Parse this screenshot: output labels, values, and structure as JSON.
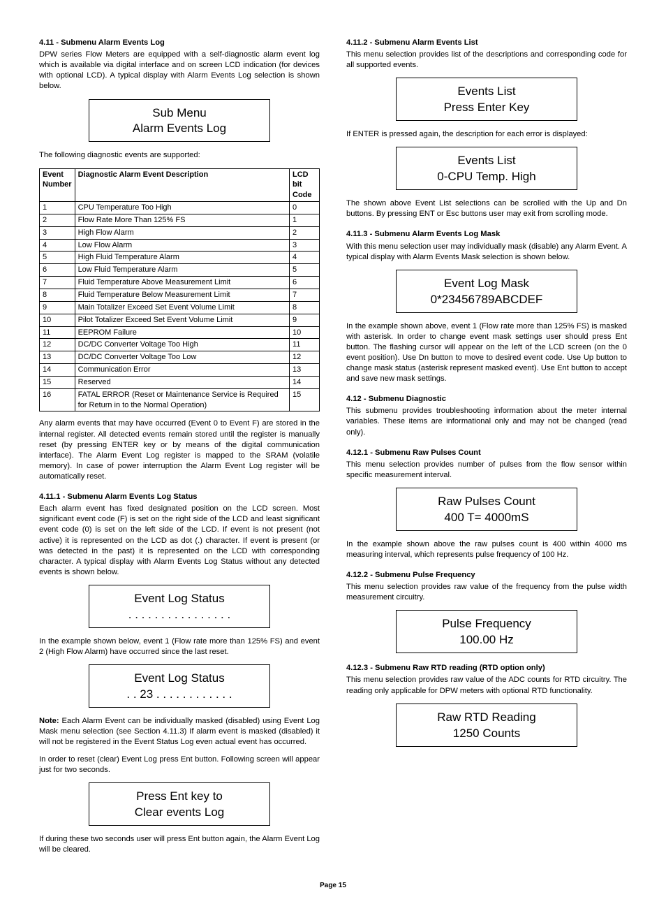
{
  "left": {
    "s411_head": "4.11 - Submenu Alarm Events Log",
    "s411_p1": "DPW series Flow Meters are equipped with a self-diagnostic alarm event log which is available via digital interface and on screen LCD indication (for devices with optional LCD). A typical display with Alarm Events Log selection is shown below.",
    "lcd1_l1": "Sub Menu",
    "lcd1_l2": "Alarm Events Log",
    "s411_p2": "The following diagnostic events are supported:",
    "table": {
      "h1": "Event Number",
      "h2": "Diagnostic Alarm Event Description",
      "h3": "LCD bit Code",
      "rows": [
        {
          "n": "1",
          "d": "CPU Temperature Too High",
          "c": "0"
        },
        {
          "n": "2",
          "d": "Flow Rate More Than 125% FS",
          "c": "1"
        },
        {
          "n": "3",
          "d": "High Flow Alarm",
          "c": "2"
        },
        {
          "n": "4",
          "d": "Low Flow Alarm",
          "c": "3"
        },
        {
          "n": "5",
          "d": "High Fluid Temperature Alarm",
          "c": "4"
        },
        {
          "n": "6",
          "d": "Low Fluid Temperature Alarm",
          "c": "5"
        },
        {
          "n": "7",
          "d": "Fluid Temperature Above Measurement Limit",
          "c": "6"
        },
        {
          "n": "8",
          "d": "Fluid Temperature Below Measurement Limit",
          "c": "7"
        },
        {
          "n": "9",
          "d": "Main Totalizer Exceed Set Event Volume Limit",
          "c": "8"
        },
        {
          "n": "10",
          "d": "Pilot Totalizer Exceed Set Event Volume Limit",
          "c": "9"
        },
        {
          "n": "11",
          "d": "EEPROM Failure",
          "c": "10"
        },
        {
          "n": "12",
          "d": "DC/DC Converter Voltage Too High",
          "c": "11"
        },
        {
          "n": "13",
          "d": "DC/DC Converter Voltage Too Low",
          "c": "12"
        },
        {
          "n": "14",
          "d": "Communication Error",
          "c": "13"
        },
        {
          "n": "15",
          "d": "Reserved",
          "c": "14"
        },
        {
          "n": "16",
          "d": "FATAL ERROR (Reset or Maintenance Service is Required for Return in to the Normal Operation)",
          "c": "15"
        }
      ]
    },
    "s411_p3": "Any alarm events that may have occurred (Event 0 to Event F) are stored in the internal register. All detected events remain stored until the register is manually reset (by pressing ENTER key or by means of the digital communication interface). The Alarm Event Log register is mapped to the SRAM (volatile memory). In case of power interruption the Alarm Event Log register will be automatically reset.",
    "s4111_head": "4.11.1 - Submenu Alarm Events Log Status",
    "s4111_p1": "Each alarm event has fixed designated position on the LCD screen. Most significant event code (F) is set on the right side of the LCD and least significant event code (0) is set on the left side of the LCD. If event is not present (not active) it is represented on the LCD as dot (.) character. If event is present (or was detected in the past) it is represented on the LCD with corresponding character. A typical display with Alarm Events Log Status without any detected events is shown below.",
    "lcd2_l1": "Event Log Status",
    "lcd2_l2": ". . . . . . . . . . . . . . . .",
    "s4111_p2": "In the example shown below, event 1 (Flow rate more than 125% FS) and event 2 (High Flow Alarm) have occurred since the last reset.",
    "lcd3_l1": "Event Log Status",
    "lcd3_l2": ". . 23 . . . . . . . . . . . .",
    "note_lead": "Note:",
    "note_body": " Each Alarm Event can be individually masked (disabled) using Event Log Mask menu selection (see Section 4.11.3) If alarm event is masked (disabled) it will not be registered in the Event Status Log even actual event has occurred.",
    "s4111_p3": "In order to reset (clear) Event Log press Ent button. Following screen will appear just for two seconds.",
    "lcd4_l1": "Press Ent key to",
    "lcd4_l2": "Clear events Log",
    "s4111_p4": "If during these two seconds user will press Ent button again, the Alarm Event Log will be cleared."
  },
  "right": {
    "s4112_head": "4.11.2 - Submenu Alarm Events List",
    "s4112_p1": "This menu selection provides list of the descriptions and corresponding code for all supported events.",
    "lcd5_l1": "Events List",
    "lcd5_l2": "Press Enter Key",
    "s4112_p2": "If ENTER is pressed again, the description for each error is displayed:",
    "lcd6_l1": "Events List",
    "lcd6_l2": "0-CPU Temp. High",
    "s4112_p3": "The shown above Event List selections can be scrolled with the Up and Dn buttons. By pressing ENT or Esc buttons user may exit from scrolling mode.",
    "s4113_head": "4.11.3 - Submenu Alarm Events Log Mask",
    "s4113_p1": "With this menu selection user may individually mask (disable) any Alarm Event. A typical display with Alarm Events Mask selection is shown below.",
    "lcd7_l1": "Event Log Mask",
    "lcd7_l2": "0*23456789ABCDEF",
    "s4113_p2": "In the example shown above, event 1 (Flow rate more than 125% FS) is masked with asterisk. In order to change event mask settings user should press Ent button. The flashing cursor will appear on the left of the LCD screen (on the 0 event position). Use Dn button to move to desired event code. Use Up button to change mask status (asterisk represent masked event). Use Ent button to accept and save new mask settings.",
    "s412_head": "4.12 - Submenu Diagnostic",
    "s412_p1": "This submenu provides troubleshooting information about the meter internal variables. These items are informational only and may not be changed (read only).",
    "s4121_head": "4.12.1 - Submenu Raw Pulses Count",
    "s4121_p1": "This menu selection provides number of pulses from the flow sensor within specific measurement interval.",
    "lcd8_l1": "Raw Pulses Count",
    "lcd8_l2": "400  T= 4000mS",
    "s4121_p2": "In the example shown above the raw pulses count is 400 within 4000 ms measuring interval, which represents pulse frequency of 100 Hz.",
    "s4122_head": "4.12.2 - Submenu Pulse Frequency",
    "s4122_p1": "This menu selection provides raw value of the frequency from the pulse width measurement circuitry.",
    "lcd9_l1": "Pulse Frequency",
    "lcd9_l2": "100.00 Hz",
    "s4123_head": "4.12.3 - Submenu Raw RTD reading (RTD option only)",
    "s4123_p1": "This menu selection provides raw value of the ADC counts for RTD circuitry. The reading only applicable for DPW meters with optional RTD functionality.",
    "lcd10_l1": "Raw RTD Reading",
    "lcd10_l2": "1250 Counts"
  },
  "footer": "Page 15"
}
